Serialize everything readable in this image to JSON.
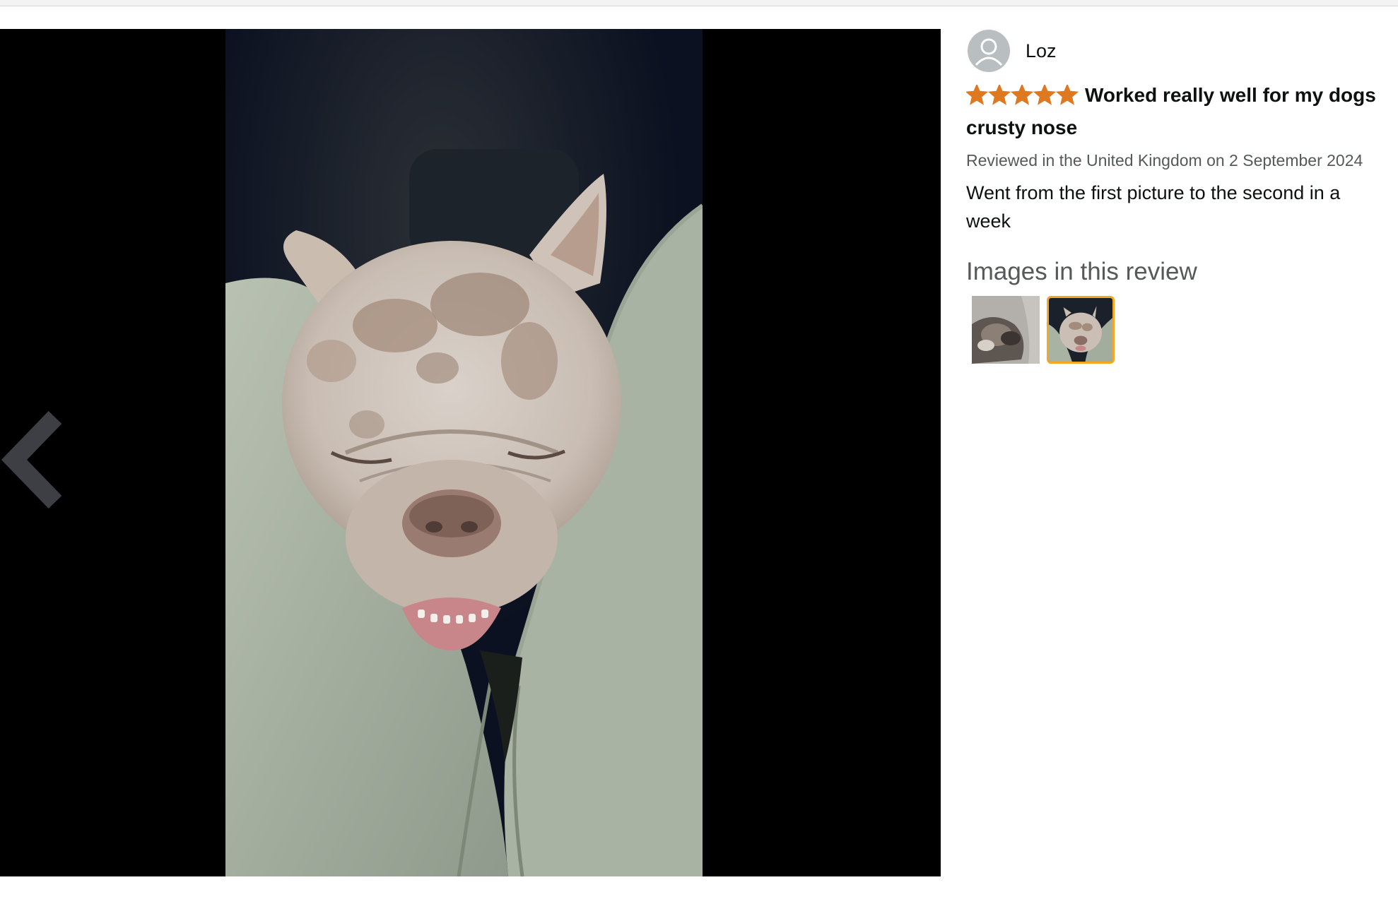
{
  "viewer": {
    "main_image_alt": "French bulldog asleep resting its head between a person's knees",
    "prev_control": "chevron-left-icon"
  },
  "review": {
    "reviewer_name": "Loz",
    "rating": 5,
    "rating_max": 5,
    "title": "Worked really well for my dogs crusty nose",
    "meta": "Reviewed in the United Kingdom on 2 September 2024",
    "body": "Went from the first picture to the second in a week"
  },
  "gallery": {
    "heading": "Images in this review",
    "selected_index": 1,
    "thumbnails": [
      "dog-photo-before",
      "dog-photo-after"
    ]
  },
  "colors": {
    "star": "#de7921",
    "selected_border": "#f5a623",
    "viewer_bg": "#000000"
  }
}
